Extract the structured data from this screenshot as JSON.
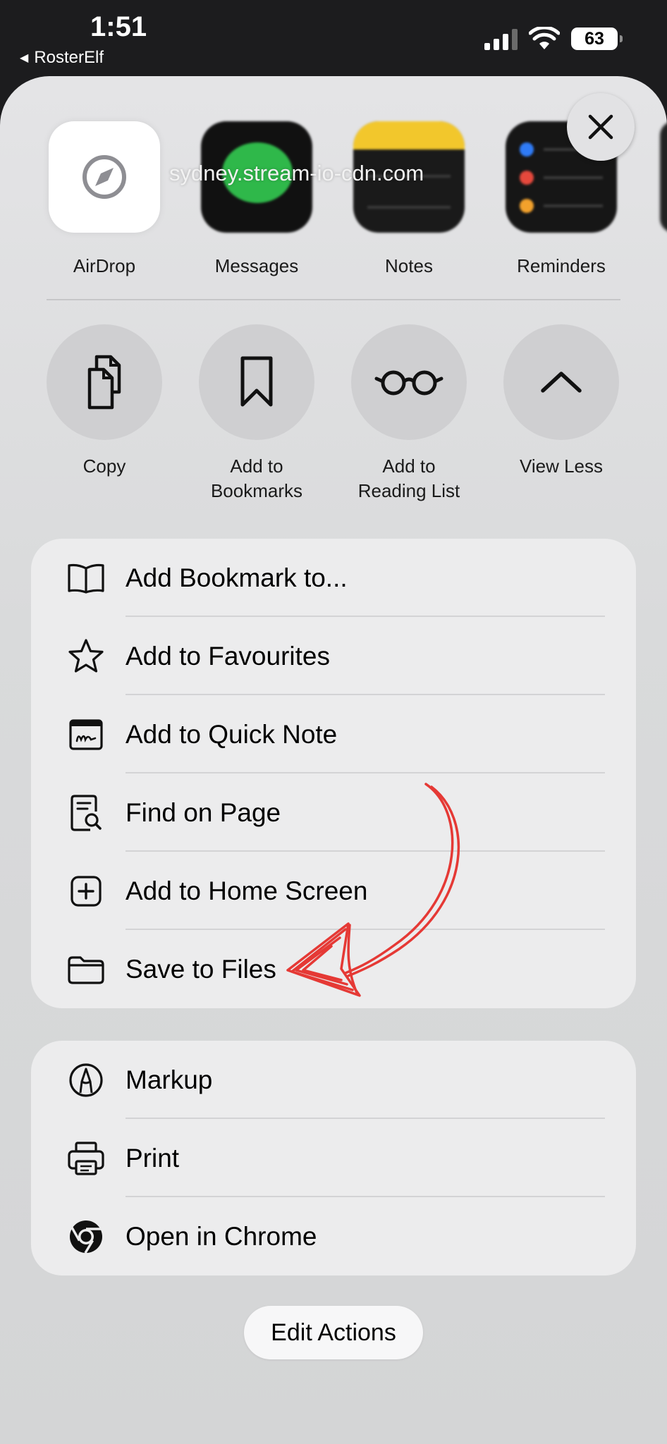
{
  "status_bar": {
    "time": "1:51",
    "back_app": "RosterElf",
    "battery": "63"
  },
  "url": "sydney.stream-io-cdn.com",
  "apps": [
    {
      "label": "AirDrop",
      "icon": "compass-icon"
    },
    {
      "label": "Messages",
      "icon": "messages-icon"
    },
    {
      "label": "Notes",
      "icon": "notes-icon"
    },
    {
      "label": "Reminders",
      "icon": "reminders-icon"
    }
  ],
  "actions": [
    {
      "label_1": "Copy",
      "label_2": "",
      "icon": "copy-icon"
    },
    {
      "label_1": "Add to",
      "label_2": "Bookmarks",
      "icon": "bookmark-icon"
    },
    {
      "label_1": "Add to",
      "label_2": "Reading List",
      "icon": "glasses-icon"
    },
    {
      "label_1": "View Less",
      "label_2": "",
      "icon": "chevron-up-icon"
    }
  ],
  "menu_group_1": [
    {
      "label": "Add Bookmark to...",
      "icon": "book-icon"
    },
    {
      "label": "Add to Favourites",
      "icon": "star-icon"
    },
    {
      "label": "Add to Quick Note",
      "icon": "quick-note-icon"
    },
    {
      "label": "Find on Page",
      "icon": "find-on-page-icon"
    },
    {
      "label": "Add to Home Screen",
      "icon": "add-square-icon"
    },
    {
      "label": "Save to Files",
      "icon": "folder-icon"
    }
  ],
  "menu_group_2": [
    {
      "label": "Markup",
      "icon": "markup-icon"
    },
    {
      "label": "Print",
      "icon": "printer-icon"
    },
    {
      "label": "Open in Chrome",
      "icon": "chrome-icon"
    }
  ],
  "edit_actions_label": "Edit Actions",
  "annotation_color": "#e53935"
}
